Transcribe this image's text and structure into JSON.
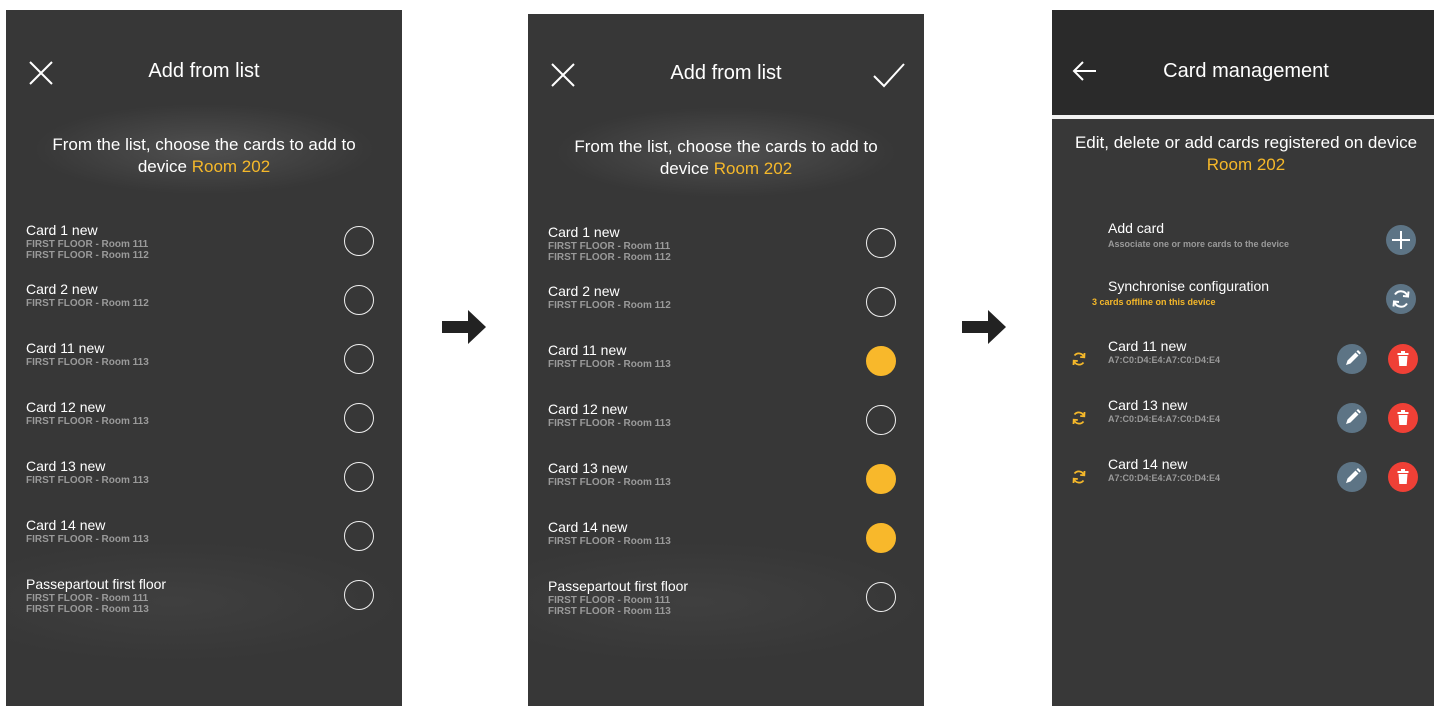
{
  "colors": {
    "accent": "#f8b82b",
    "delete": "#ef4036",
    "action": "#5d7485",
    "background": "#373737"
  },
  "screen1": {
    "title": "Add from list",
    "close_icon": "close-icon",
    "intro_text": "From the list, choose the cards to add to device",
    "device": "Room 202",
    "items": [
      {
        "name": "Card 1 new",
        "subs": [
          "FIRST FLOOR - Room 111",
          "FIRST FLOOR - Room 112"
        ],
        "selected": false
      },
      {
        "name": "Card 2 new",
        "subs": [
          "FIRST FLOOR - Room 112"
        ],
        "selected": false
      },
      {
        "name": "Card 11 new",
        "subs": [
          "FIRST FLOOR - Room 113"
        ],
        "selected": false
      },
      {
        "name": "Card 12 new",
        "subs": [
          "FIRST FLOOR - Room 113"
        ],
        "selected": false
      },
      {
        "name": "Card 13 new",
        "subs": [
          "FIRST FLOOR - Room 113"
        ],
        "selected": false
      },
      {
        "name": "Card 14 new",
        "subs": [
          "FIRST FLOOR - Room 113"
        ],
        "selected": false
      },
      {
        "name": "Passepartout first floor",
        "subs": [
          "FIRST FLOOR - Room 111",
          "FIRST FLOOR - Room 113"
        ],
        "selected": false
      }
    ]
  },
  "screen2": {
    "title": "Add from list",
    "close_icon": "close-icon",
    "confirm_icon": "checkmark-icon",
    "intro_text": "From the list, choose the cards to add to device",
    "device": "Room 202",
    "items": [
      {
        "name": "Card 1 new",
        "subs": [
          "FIRST FLOOR - Room 111",
          "FIRST FLOOR - Room 112"
        ],
        "selected": false
      },
      {
        "name": "Card 2 new",
        "subs": [
          "FIRST FLOOR - Room 112"
        ],
        "selected": false
      },
      {
        "name": "Card 11 new",
        "subs": [
          "FIRST FLOOR - Room 113"
        ],
        "selected": true
      },
      {
        "name": "Card 12 new",
        "subs": [
          "FIRST FLOOR - Room 113"
        ],
        "selected": false
      },
      {
        "name": "Card 13 new",
        "subs": [
          "FIRST FLOOR - Room 113"
        ],
        "selected": true
      },
      {
        "name": "Card 14 new",
        "subs": [
          "FIRST FLOOR - Room 113"
        ],
        "selected": true
      },
      {
        "name": "Passepartout first floor",
        "subs": [
          "FIRST FLOOR - Room 111",
          "FIRST FLOOR - Room 113"
        ],
        "selected": false
      }
    ]
  },
  "screen3": {
    "title": "Card management",
    "back_icon": "back-arrow-icon",
    "intro_text": "Edit, delete or add cards registered on device",
    "device": "Room 202",
    "add_card": {
      "title": "Add card",
      "subtitle": "Associate one or more cards to the device",
      "icon": "plus-icon"
    },
    "sync": {
      "title": "Synchronise configuration",
      "subtitle": "3 cards offline on this device",
      "icon": "sync-icon"
    },
    "cards": [
      {
        "name": "Card 11 new",
        "code": "A7:C0:D4:E4:A7:C0:D4:E4"
      },
      {
        "name": "Card 13 new",
        "code": "A7:C0:D4:E4:A7:C0:D4:E4"
      },
      {
        "name": "Card 14 new",
        "code": "A7:C0:D4:E4:A7:C0:D4:E4"
      }
    ]
  },
  "flow_arrow_icon": "right-arrow-icon"
}
